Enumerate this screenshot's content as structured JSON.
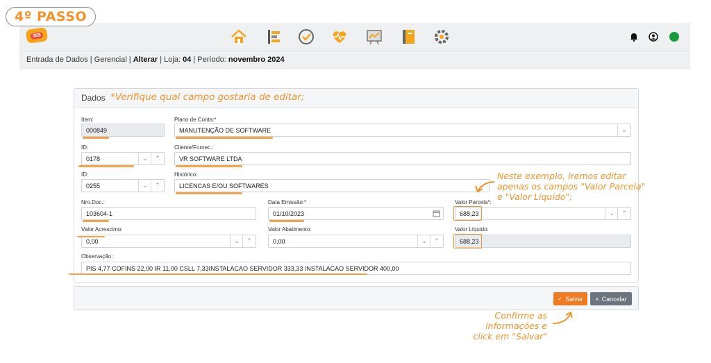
{
  "step_badge": "4º PASSO",
  "topbar": {
    "logo_text": "365",
    "nav_icons": [
      "home-icon",
      "timeline-icon",
      "check-circle-icon",
      "heart-pulse-icon",
      "chart-board-icon",
      "notebook-icon",
      "gear-cluster-icon"
    ],
    "right_icons": [
      "bell-icon",
      "user-circle-icon",
      "status-dot-icon"
    ],
    "status_color": "#1b9a3a"
  },
  "breadcrumb": {
    "prefix": "Entrada de Dados | Gerencial | ",
    "action": "Alterar",
    "loja_label": " | Loja: ",
    "loja": "04",
    "periodo_label": " | Período: ",
    "periodo": "novembro 2024"
  },
  "panel": {
    "title": "Dados"
  },
  "annotations": {
    "verify": "*Verifique qual campo gostaria de editar;",
    "example_line1": "Neste exemplo, iremos editar",
    "example_line2": "apenas os campos \"Valor Parcela\"",
    "example_line3": "e \"Valor Líquido\";",
    "confirm_line1": "Confirme as",
    "confirm_line2": "informações e",
    "confirm_line3": "click em \"Salvar\""
  },
  "form": {
    "item_label": "Item:",
    "item_value": "000849",
    "plano_label": "Plano de Conta:*",
    "plano_value": "MANUTENÇÃO DE SOFTWARE",
    "id1_label": "ID:",
    "id1_value": "0178",
    "cliente_label": "Cliente/Fornec.:",
    "cliente_value": "VR SOFTWARE LTDA",
    "id2_label": "ID:",
    "id2_value": "0255",
    "historico_label": "Histórico:",
    "historico_value": "LICENCAS E/OU SOFTWARES",
    "nrodoc_label": "Nro.Doc.:",
    "nrodoc_value": "103604-1",
    "emissao_label": "Data Emissão:*",
    "emissao_value": "01/10/2023",
    "parcela_label": "Valor Parcela*:",
    "parcela_value": "688,23",
    "acrescimo_label": "Valor Acrescimo:",
    "acrescimo_value": "0,00",
    "abatimento_label": "Valor Abatimento:",
    "abatimento_value": "0,00",
    "liquido_label": "Valor Líquido:",
    "liquido_value": "688,23",
    "obs_label": "Observação:",
    "obs_value": "PIS 4,77 COFINS 22,00 IR 11,00 CSLL 7,33INSTALACAO SERVIDOR 333,33  INSTALACAO SERVIDOR 400,00"
  },
  "buttons": {
    "save": "Salvar",
    "cancel": "Cancelar"
  },
  "colors": {
    "accent": "#f0932b",
    "save_bg": "#f07a22",
    "cancel_bg": "#6c757d"
  }
}
